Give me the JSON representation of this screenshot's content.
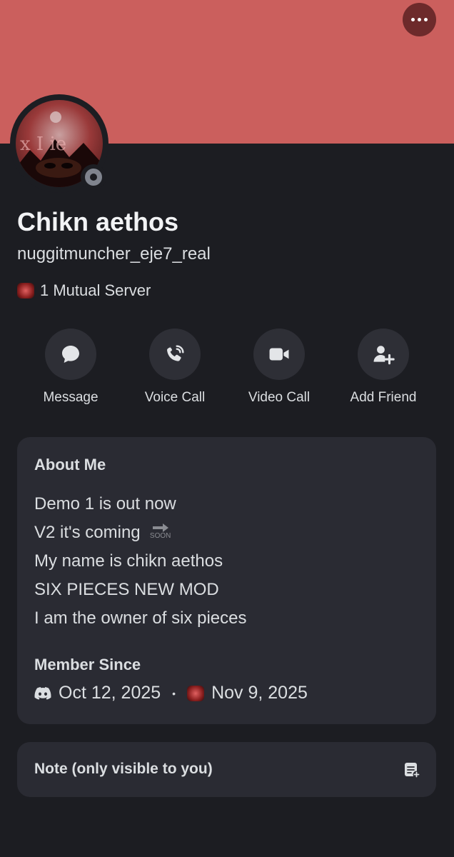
{
  "profile": {
    "display_name": "Chikn aethos",
    "username": "nuggitmuncher_eje7_real",
    "mutual_servers": "1 Mutual Server",
    "status": "offline"
  },
  "actions": [
    {
      "label": "Message",
      "icon": "chat-bubble-icon"
    },
    {
      "label": "Voice Call",
      "icon": "phone-icon"
    },
    {
      "label": "Video Call",
      "icon": "video-camera-icon"
    },
    {
      "label": "Add Friend",
      "icon": "add-friend-icon"
    }
  ],
  "about": {
    "title": "About Me",
    "lines": [
      "Demo 1 is out now",
      "V2 it's coming",
      "My name is chikn aethos",
      "SIX PIECES NEW MOD",
      "I am the owner of six pieces"
    ],
    "soon_emoji_text": "SOON"
  },
  "member_since": {
    "title": "Member Since",
    "discord_date": "Oct 12, 2025",
    "separator": "•",
    "server_date": "Nov 9, 2025"
  },
  "note": {
    "label": "Note (only visible to you)"
  },
  "colors": {
    "banner": "#cb5f5d",
    "background": "#1c1d22",
    "card": "#2a2b33",
    "action_button": "#2e2f36"
  }
}
